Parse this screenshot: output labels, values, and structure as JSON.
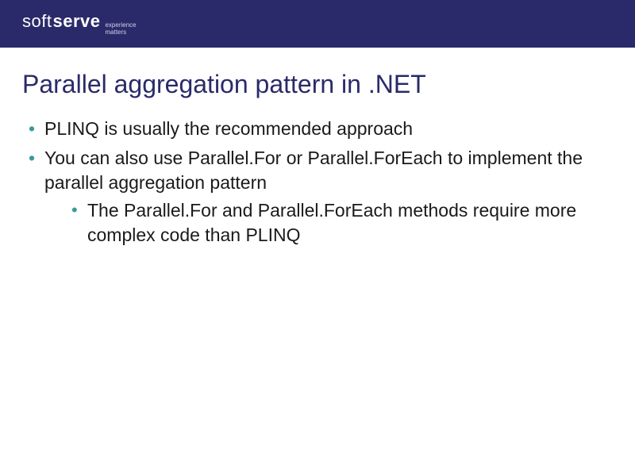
{
  "header": {
    "logo_part1": "soft",
    "logo_part2": "serve",
    "tagline_line1": "experience",
    "tagline_line2": "matters"
  },
  "slide": {
    "title": "Parallel aggregation pattern in .NET",
    "bullets": [
      {
        "text": "PLINQ is usually the recommended approach"
      },
      {
        "text": "You can also use Parallel.For or Parallel.ForEach to implement the parallel aggregation pattern",
        "sub": [
          "The Parallel.For and Parallel.ForEach methods require more complex code than PLINQ"
        ]
      }
    ]
  }
}
